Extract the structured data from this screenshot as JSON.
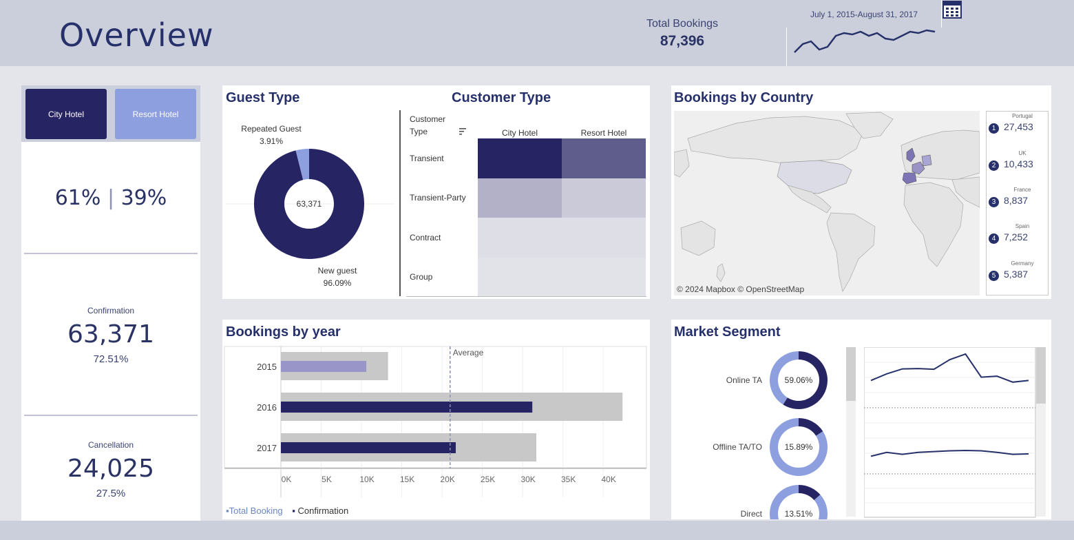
{
  "header": {
    "title": "Overview",
    "total_bookings_label": "Total Bookings",
    "total_bookings_value": "87,396",
    "date_range": "July 1, 2015-August 31, 2017"
  },
  "hotel_filter": {
    "city_label": "City Hotel",
    "resort_label": "Resort Hotel"
  },
  "split": {
    "city": "61%",
    "separator": "|",
    "resort": "39%"
  },
  "confirmation": {
    "label": "Confirmation",
    "value": "63,371",
    "pct": "72.51%"
  },
  "cancellation": {
    "label": "Cancellation",
    "value": "24,025",
    "pct": "27.5%"
  },
  "guest_type": {
    "title": "Guest Type",
    "center_value": "63,371",
    "repeated_label": "Repeated Guest",
    "repeated_pct": "3.91%",
    "new_label": "New guest",
    "new_pct": "96.09%"
  },
  "customer_type": {
    "title": "Customer Type",
    "header_label_line1": "Customer",
    "header_label_line2": "Type",
    "columns": [
      "City Hotel",
      "Resort Hotel"
    ],
    "rows": [
      "Transient",
      "Transient-Party",
      "Contract",
      "Group"
    ]
  },
  "bookings_by_year": {
    "title": "Bookings by year",
    "average_label": "Average",
    "legend_total": "Total Booking",
    "legend_confirmation": "Confirmation"
  },
  "bookings_by_country": {
    "title": "Bookings by Country",
    "credit": "© 2024 Mapbox  © OpenStreetMap",
    "top": [
      {
        "rank": "1",
        "country": "Portugal",
        "value": "27,453"
      },
      {
        "rank": "2",
        "country": "UK",
        "value": "10,433"
      },
      {
        "rank": "3",
        "country": "France",
        "value": "8,837"
      },
      {
        "rank": "4",
        "country": "Spain",
        "value": "7,252"
      },
      {
        "rank": "5",
        "country": "Germany",
        "value": "5,387"
      }
    ]
  },
  "market_segment": {
    "title": "Market Segment",
    "segments": [
      {
        "name": "Online TA",
        "pct": "59.06%"
      },
      {
        "name": "Offline TA/TO",
        "pct": "15.89%"
      },
      {
        "name": "Direct",
        "pct": "13.51%"
      }
    ]
  },
  "colors": {
    "navy": "#272463",
    "periwinkle": "#8e9fe0",
    "grey_bar": "#c8c8c8",
    "lavender_bar": "#9a95c9"
  },
  "chart_data": [
    {
      "type": "bar",
      "title": "Bookings by year",
      "orientation": "horizontal",
      "categories": [
        "2015",
        "2016",
        "2017"
      ],
      "series": [
        {
          "name": "Total Booking",
          "values": [
            13300,
            42400,
            31700
          ]
        },
        {
          "name": "Confirmation",
          "values": [
            10600,
            31200,
            21700
          ]
        }
      ],
      "reference_line": {
        "label": "Average",
        "value": 21000
      },
      "xlim": [
        0,
        44000
      ],
      "xticks": [
        "0K",
        "5K",
        "10K",
        "15K",
        "20K",
        "25K",
        "30K",
        "35K",
        "40K"
      ]
    },
    {
      "type": "pie",
      "title": "Guest Type",
      "categories": [
        "New guest",
        "Repeated Guest"
      ],
      "values": [
        96.09,
        3.91
      ]
    },
    {
      "type": "heatmap",
      "title": "Customer Type",
      "x": [
        "City Hotel",
        "Resort Hotel"
      ],
      "y": [
        "Transient",
        "Transient-Party",
        "Contract",
        "Group"
      ],
      "values": [
        [
          1.0,
          0.72
        ],
        [
          0.3,
          0.18
        ],
        [
          0.08,
          0.08
        ],
        [
          0.06,
          0.06
        ]
      ]
    },
    {
      "type": "line",
      "title": "Total Bookings",
      "values": [
        1,
        4,
        5,
        2,
        3,
        7,
        8,
        7.5,
        8.5,
        7,
        8,
        6,
        5.5,
        7,
        8.5,
        8,
        9,
        8.5
      ]
    },
    {
      "type": "pie",
      "title": "Market Segment",
      "categories": [
        "Online TA",
        "Offline TA/TO",
        "Direct"
      ],
      "values": [
        59.06,
        15.89,
        13.51
      ]
    },
    {
      "type": "line",
      "title": "Market Segment trend",
      "series": [
        {
          "name": "Online TA",
          "values": [
            2,
            4,
            5.5,
            5.6,
            5.4,
            8.3,
            10,
            3,
            3.3,
            1.5,
            2
          ]
        },
        {
          "name": "Offline TA/TO",
          "values": [
            1,
            2,
            1.5,
            2,
            2.2,
            2.4,
            2.5,
            2.4,
            2,
            1.5,
            1.6
          ]
        }
      ]
    }
  ]
}
